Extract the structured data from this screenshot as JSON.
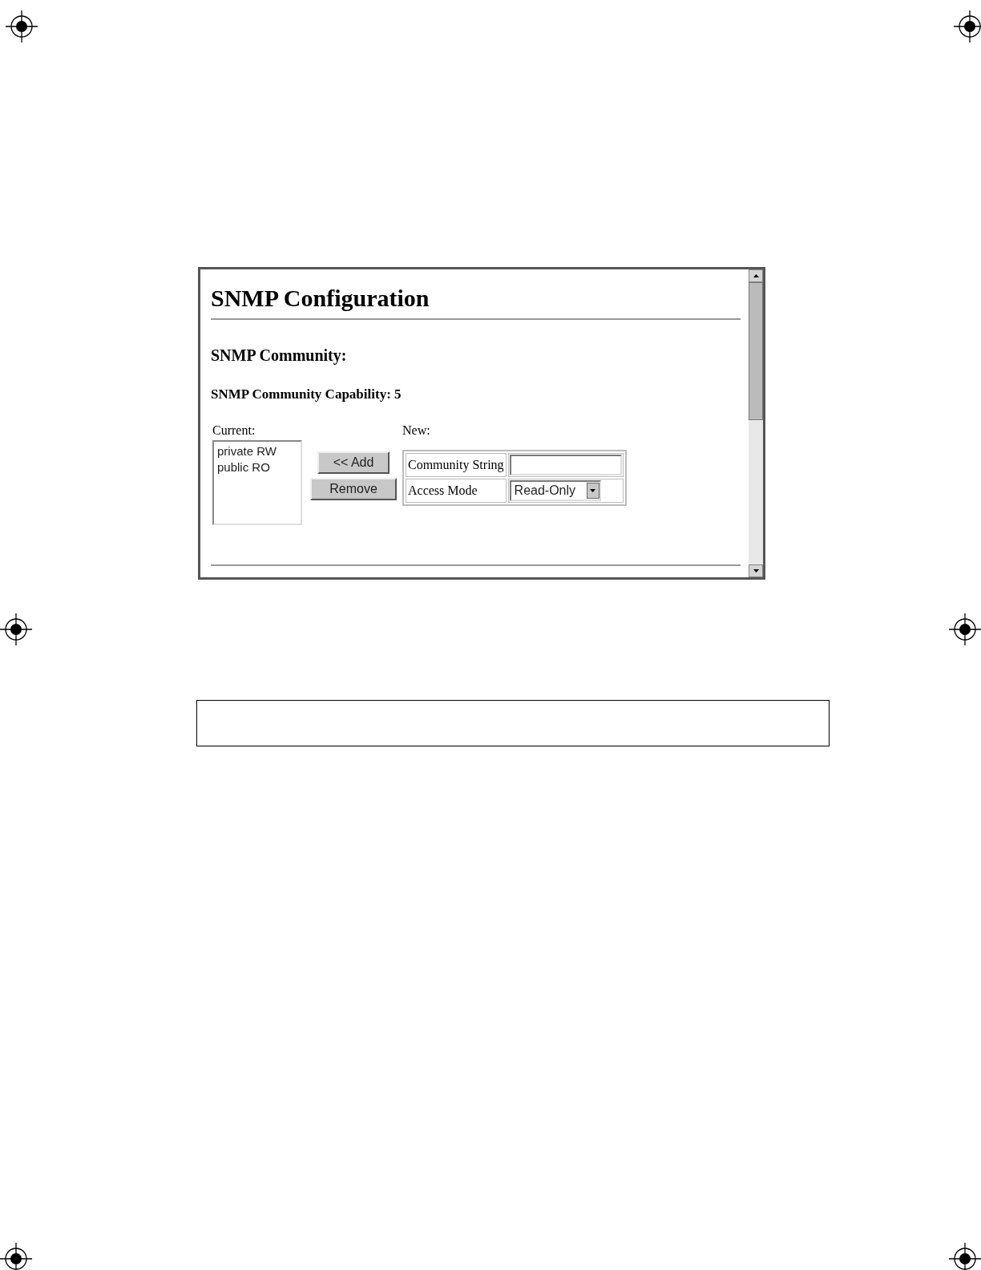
{
  "window": {
    "title": "SNMP Configuration"
  },
  "section": {
    "heading": "SNMP Community:",
    "capability": "SNMP Community Capability: 5"
  },
  "current": {
    "label": "Current:",
    "items": [
      "private RW",
      "public RO"
    ]
  },
  "buttons": [
    "<< Add",
    "Remove"
  ],
  "new": {
    "label": "New:",
    "fields": [
      {
        "kind": "text",
        "label": "Community String"
      },
      {
        "kind": "select",
        "label": "Access Mode",
        "value": "Read-Only"
      }
    ]
  }
}
